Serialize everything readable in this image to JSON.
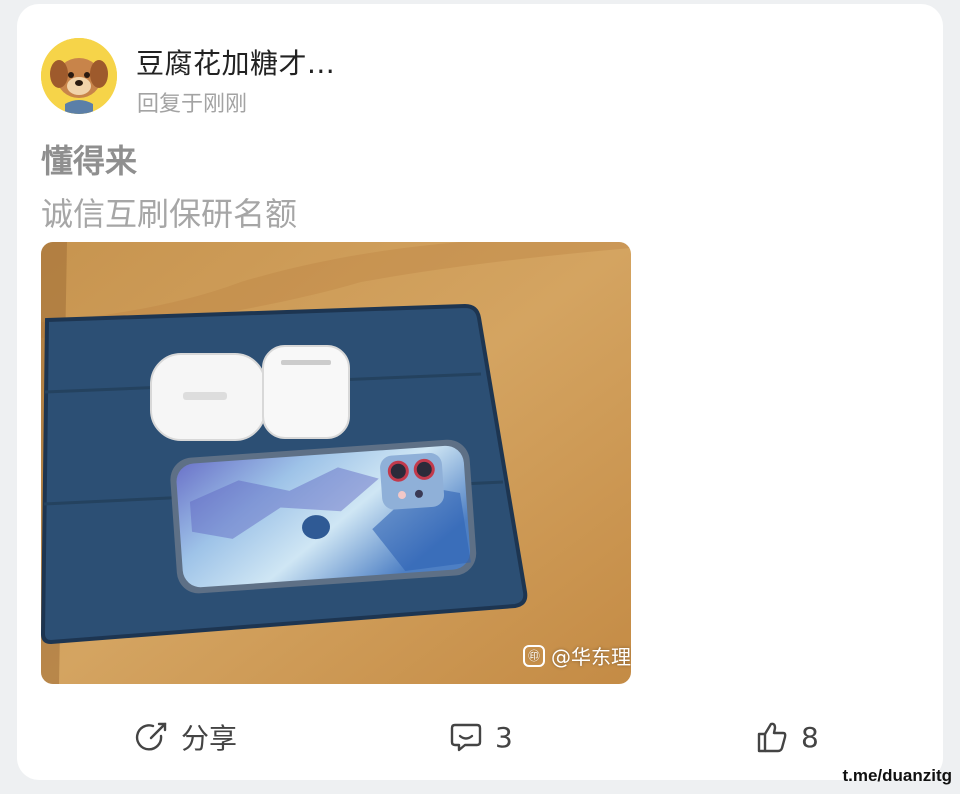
{
  "post": {
    "author": {
      "name": "豆腐花加糖才...",
      "avatar_icon": "dog-avatar"
    },
    "reply_time": "回复于刚刚",
    "title": "懂得来",
    "body": "诚信互刷保研名额",
    "image": {
      "watermark_logo": "㊞",
      "watermark_text": "@华东理"
    }
  },
  "actions": {
    "share": {
      "icon": "share-icon",
      "label": "分享"
    },
    "comment": {
      "icon": "comment-icon",
      "count": "3"
    },
    "like": {
      "icon": "thumbs-up-icon",
      "count": "8"
    }
  },
  "footer": {
    "source_mark": "t.me/duanzitg"
  },
  "colors": {
    "background": "#eef0f2",
    "card": "#ffffff",
    "title_text": "#8f8f8f",
    "body_text": "#a6a6a6",
    "meta_text": "#a3a3a3"
  }
}
